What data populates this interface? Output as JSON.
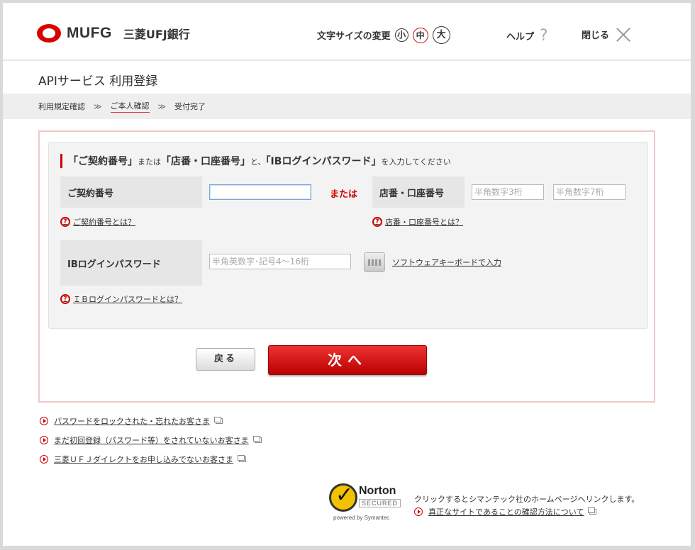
{
  "header": {
    "logo_text": "MUFG",
    "bank_name": "三菱UFJ銀行",
    "font_size_label": "文字サイズの変更",
    "font_sizes": [
      "小",
      "中",
      "大"
    ],
    "help_label": "ヘルプ",
    "close_label": "閉じる"
  },
  "page_title": "APIサービス 利用登録",
  "steps": {
    "step1": "利用規定確認",
    "sep": "≫",
    "step2": "ご本人確認",
    "step3": "受付完了"
  },
  "form": {
    "instruction": {
      "q1": "「ご契約番号」",
      "t1": "または",
      "q2": "「店番・口座番号」",
      "t2": "と、",
      "q3": "「IBログインパスワード」",
      "t3": "を入力してください"
    },
    "contract_label": "ご契約番号",
    "contract_value": "",
    "or_text": "または",
    "branch_label": "店番・口座番号",
    "branch_placeholder": "半角数字3桁",
    "account_placeholder": "半角数字7桁",
    "contract_help": "ご契約番号とは？",
    "branch_help": "店番・口座番号とは？",
    "password_label": "IBログインパスワード",
    "password_placeholder": "半角英数字･記号4～16桁",
    "keyboard_link": "ソフトウェアキーボードで入力",
    "password_help": "ＩＢログインパスワードとは？",
    "back_label": "戻る",
    "next_label": "次へ",
    "help_icon_glyph": "?"
  },
  "footer_links": [
    "パスワードをロックされた・忘れたお客さま",
    "まだ初回登録（パスワード等）をされていないお客さま",
    "三菱ＵＦＪダイレクトをお申し込みでないお客さま"
  ],
  "norton": {
    "name": "Norton",
    "secured": "SECURED",
    "powered": "powered by Symantec",
    "description": "クリックするとシマンテック社のホームページへリンクします。",
    "verify_link": "真正なサイトであることの確認方法について"
  },
  "colors": {
    "brand_red": "#d90000",
    "button_red": "#c00",
    "form_border": "#f2c8c8"
  }
}
